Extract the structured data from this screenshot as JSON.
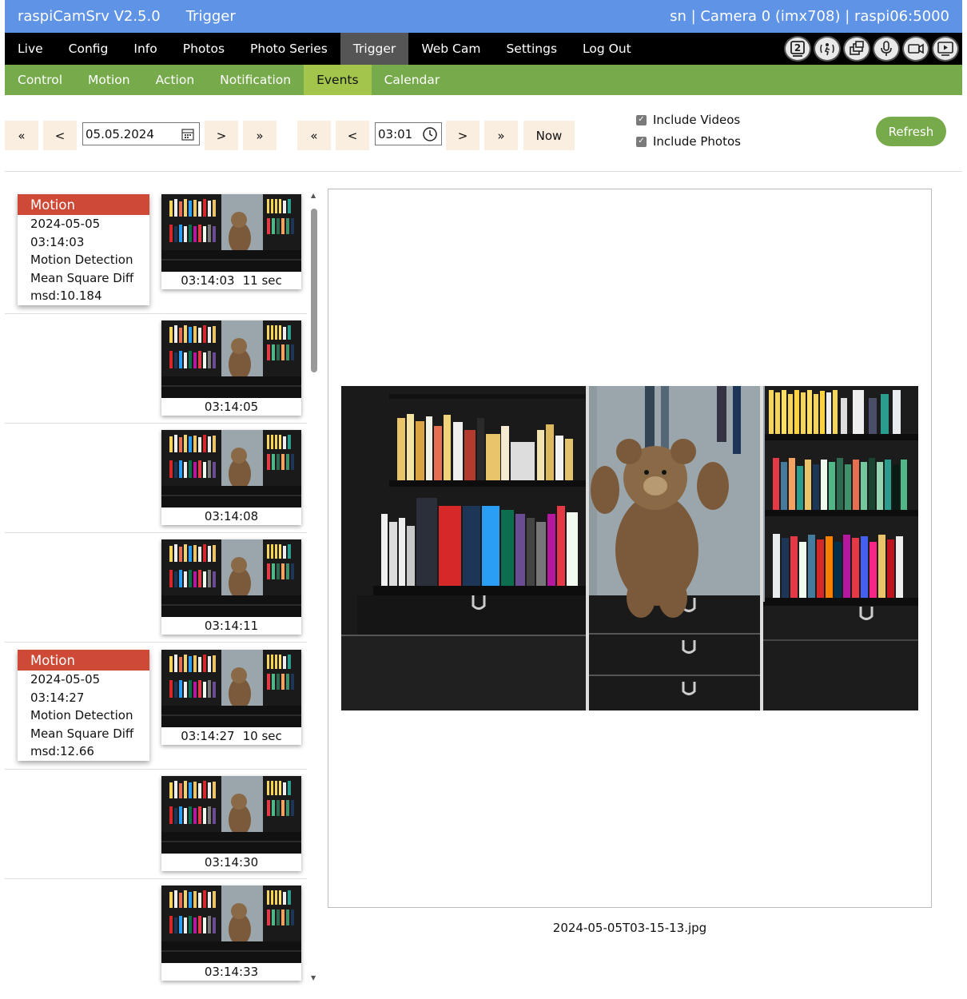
{
  "header": {
    "app_title": "raspiCamSrv V2.5.0",
    "page_title": "Trigger",
    "status": "sn | Camera 0 (imx708) | raspi06:5000"
  },
  "main_nav": {
    "items": [
      "Live",
      "Config",
      "Info",
      "Photos",
      "Photo Series",
      "Trigger",
      "Web Cam",
      "Settings",
      "Log Out"
    ],
    "active": "Trigger",
    "icons": [
      "camera-2-icon",
      "motion-icon",
      "windows-icon",
      "microphone-icon",
      "video-camera-icon",
      "play-screen-icon"
    ]
  },
  "sub_nav": {
    "items": [
      "Control",
      "Motion",
      "Action",
      "Notification",
      "Events",
      "Calendar"
    ],
    "active": "Events"
  },
  "controls": {
    "date_first": "«",
    "date_prev": "<",
    "date_value": "05.05.2024",
    "date_next": ">",
    "date_last": "»",
    "time_first": "«",
    "time_prev": "<",
    "time_value": "03:01",
    "time_next": ">",
    "time_last": "»",
    "now_label": "Now",
    "include_videos": "Include Videos",
    "include_videos_checked": true,
    "include_photos": "Include Photos",
    "include_photos_checked": true,
    "refresh_label": "Refresh"
  },
  "events": [
    {
      "card": {
        "type": "Motion",
        "date": "2024-05-05",
        "time": "03:14:03",
        "method": "Motion Detection",
        "algorithm": "Mean Square Diff",
        "value": "msd:10.184"
      },
      "thumb_time": "03:14:03",
      "thumb_duration": "11 sec"
    },
    {
      "card": null,
      "thumb_time": "03:14:05",
      "thumb_duration": ""
    },
    {
      "card": null,
      "thumb_time": "03:14:08",
      "thumb_duration": ""
    },
    {
      "card": null,
      "thumb_time": "03:14:11",
      "thumb_duration": ""
    },
    {
      "card": {
        "type": "Motion",
        "date": "2024-05-05",
        "time": "03:14:27",
        "method": "Motion Detection",
        "algorithm": "Mean Square Diff",
        "value": "msd:12.66"
      },
      "thumb_time": "03:14:27",
      "thumb_duration": "10 sec"
    },
    {
      "card": null,
      "thumb_time": "03:14:30",
      "thumb_duration": ""
    },
    {
      "card": null,
      "thumb_time": "03:14:33",
      "thumb_duration": ""
    }
  ],
  "preview": {
    "filename": "2024-05-05T03-15-13.jpg"
  },
  "colors": {
    "title_bar": "#5e93e6",
    "main_nav": "#000000",
    "sub_nav": "#76aa4b",
    "sub_nav_active": "#a3c54c",
    "event_header": "#cf4a36",
    "button_bg": "#f9eee0"
  }
}
